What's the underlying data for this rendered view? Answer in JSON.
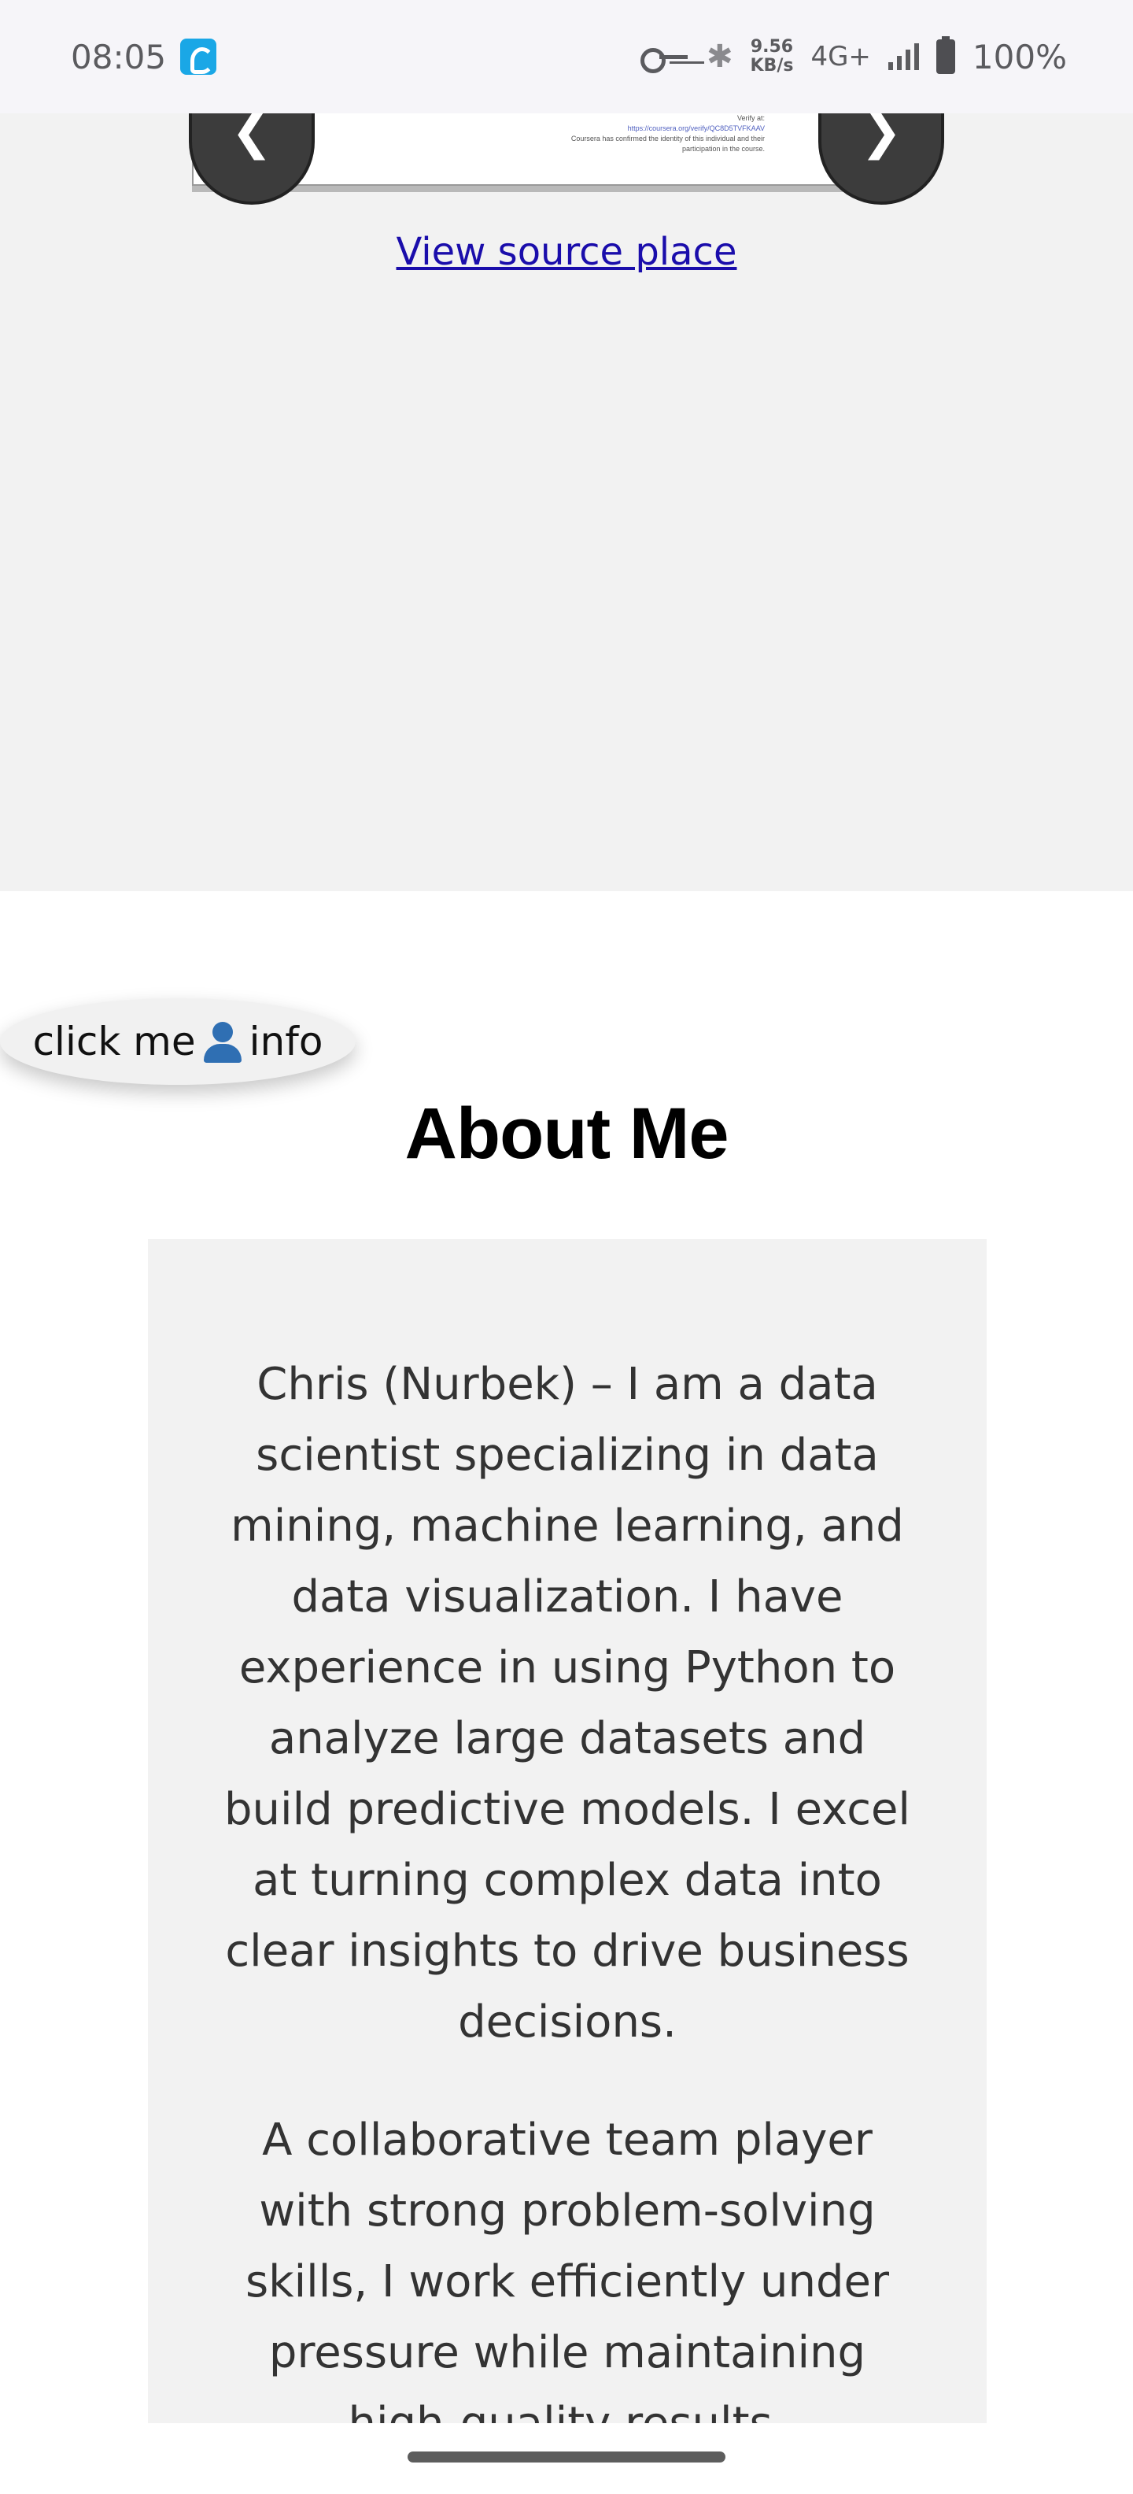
{
  "status_bar": {
    "time": "08:05",
    "speed_value": "9.56",
    "speed_unit": "KB/s",
    "network": "4G+",
    "battery": "100%"
  },
  "carousel": {
    "certificate_lines": [
      "Verify at:",
      "https://coursera.org/verify/QC8D5TVFKAAV",
      "Coursera has confirmed the identity of this individual and their",
      "participation in the course."
    ],
    "prev_arrow": "❮",
    "next_arrow": "❯",
    "source_link": "View source place"
  },
  "info_button": {
    "label_before": "click me ",
    "label_after": "info",
    "icon": "person-icon"
  },
  "about": {
    "title": "About Me",
    "paragraphs": [
      "Chris (Nurbek) – I am a data scientist specializing in data mining, machine learning, and data visualization. I have experience in using Python to analyze large datasets and build predictive models. I excel at turning complex data into clear insights to drive business decisions.",
      "A collaborative team player with strong problem-solving skills, I work efficiently under pressure while maintaining high-quality results."
    ]
  }
}
